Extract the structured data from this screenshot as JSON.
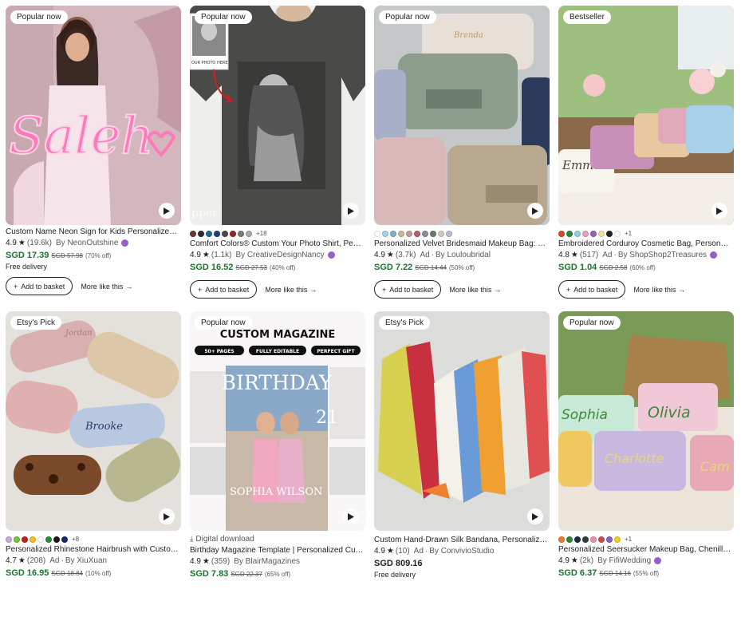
{
  "products": [
    {
      "badge": "Popular now",
      "has_video": true,
      "title": "Custom Name Neon Sign for Kids Personalized Neon Sign",
      "rating": "4.9",
      "reviews": "(19.6k)",
      "ad": "",
      "by": "By NeonOutshine",
      "star_seller": true,
      "price": "SGD 17.39",
      "was": "SGD 57.98",
      "off": "(70% off)",
      "delivery": "Free delivery",
      "add_label": "Add to basket",
      "more_label": "More like this",
      "swatches": [],
      "swatch_more": "",
      "image": {
        "icon": "neon-sign-photo",
        "text": "Saleh"
      }
    },
    {
      "badge": "Popular now",
      "has_video": true,
      "title": "Comfort Colors® Custom Your Photo Shirt, Personalized Shirt",
      "rating": "4.9",
      "reviews": "(1.1k)",
      "ad": "",
      "by": "By CreativeDesignNancy",
      "star_seller": true,
      "price": "SGD 16.52",
      "was": "SGD 27.53",
      "off": "(40% off)",
      "delivery": "",
      "add_label": "Add to basket",
      "more_label": "More like this",
      "swatches": [
        "#6b3a2a",
        "#2b2b2b",
        "#1f6a8a",
        "#1f3f7a",
        "#4a4a4a",
        "#9a2424",
        "#7a7a7a",
        "#a8a8a8"
      ],
      "swatch_more": "+18",
      "image": {
        "icon": "photo-tshirt",
        "text": "OUR PHOTO HERE"
      }
    },
    {
      "badge": "Popular now",
      "has_video": true,
      "title": "Personalized Velvet Bridesmaid Makeup Bag: Soft Velvet",
      "rating": "4.9",
      "reviews": "(3.7k)",
      "ad": "Ad",
      "by": "By Louloubridal",
      "star_seller": false,
      "price": "SGD 7.22",
      "was": "SGD 14.44",
      "off": "(50% off)",
      "delivery": "",
      "add_label": "Add to basket",
      "more_label": "More like this",
      "swatches": [
        "#ffffff",
        "#9fd0e8",
        "#7fb0c8",
        "#c9b79a",
        "#c39a9a",
        "#b06070",
        "#8a8fa0",
        "#6b7a6a",
        "#d8c8b8",
        "#c8b8d8"
      ],
      "swatch_more": "",
      "image": {
        "icon": "velvet-makeup-bags",
        "text": "Brenda"
      }
    },
    {
      "badge": "Bestseller",
      "has_video": true,
      "title": "Embroidered Corduroy Cosmetic Bag, Personalized Makeup Bag",
      "rating": "4.8",
      "reviews": "(517)",
      "ad": "Ad",
      "by": "By ShopShop2Treasures",
      "star_seller": true,
      "price": "SGD 1.04",
      "was": "SGD 2.58",
      "off": "(60% off)",
      "delivery": "",
      "add_label": "Add to basket",
      "more_label": "More like this",
      "swatches": [
        "#d24a2a",
        "#2a8a3a",
        "#8ad0e8",
        "#e8a0c0",
        "#9a60b8",
        "#f0e0a0",
        "#222222",
        "#ffffff"
      ],
      "swatch_more": "+1",
      "image": {
        "icon": "corduroy-cosmetic-bags",
        "text": "Emma"
      }
    },
    {
      "badge": "Etsy's Pick",
      "has_video": true,
      "title": "Personalized Rhinestone Hairbrush with Custom Name",
      "rating": "4.7",
      "reviews": "(208)",
      "ad": "Ad",
      "by": "By XiuXuan",
      "star_seller": false,
      "price": "SGD 16.95",
      "was": "SGD 18.84",
      "off": "(10% off)",
      "delivery": "",
      "add_label": "",
      "more_label": "",
      "swatches": [
        "#c8a8e0",
        "#7ac03a",
        "#c02020",
        "#f0c020",
        "#ffffff",
        "#2a8a3a",
        "#1a1a1a",
        "#1a2a6a"
      ],
      "swatch_more": "+8",
      "image": {
        "icon": "rhinestone-hairbrushes",
        "text": "Brooke"
      }
    },
    {
      "badge": "Popular now",
      "has_video": true,
      "digital": "Digital download",
      "title": "Birthday Magazine Template | Personalized Custom Magazine",
      "rating": "4.9",
      "reviews": "(359)",
      "ad": "",
      "by": "By BlairMagazines",
      "star_seller": false,
      "price": "SGD 7.83",
      "was": "SGD 22.37",
      "off": "(65% off)",
      "delivery": "",
      "add_label": "",
      "more_label": "",
      "swatches": [],
      "swatch_more": "",
      "image": {
        "icon": "magazine-template",
        "header": "CUSTOM MAGAZINE",
        "tags": [
          "50+ PAGES",
          "FULLY EDITABLE",
          "PERFECT GIFT"
        ],
        "cover_title": "BIRTHDAY",
        "cover_name": "SOPHIA WILSON",
        "cover_number": "21"
      }
    },
    {
      "badge": "Etsy's Pick",
      "has_video": true,
      "title": "Custom Hand-Drawn Silk Bandana, Personalized Wedding",
      "rating": "4.9",
      "reviews": "(10)",
      "ad": "Ad",
      "by": "By ConvivioStudio",
      "star_seller": false,
      "price": "SGD 809.16",
      "was": "",
      "off": "",
      "delivery": "Free delivery",
      "add_label": "",
      "more_label": "",
      "swatches": [],
      "swatch_more": "",
      "image": {
        "icon": "silk-bandanas"
      }
    },
    {
      "badge": "Popular now",
      "has_video": false,
      "title": "Personalized Seersucker Makeup Bag, Chenille Name Bag",
      "rating": "4.9",
      "reviews": "(2k)",
      "ad": "",
      "by": "By FifiWedding",
      "star_seller": true,
      "price": "SGD 6.37",
      "was": "SGD 14.16",
      "off": "(55% off)",
      "delivery": "",
      "add_label": "",
      "more_label": "",
      "swatches": [
        "#f07a30",
        "#2a8a3a",
        "#1a2a4a",
        "#3a3a3a",
        "#e890b0",
        "#d04a4a",
        "#8a60c8",
        "#f0d020"
      ],
      "swatch_more": "+1",
      "image": {
        "icon": "seersucker-makeup-bags",
        "names": [
          "Sophia",
          "Olivia",
          "Charlotte",
          "Cam"
        ]
      }
    }
  ]
}
